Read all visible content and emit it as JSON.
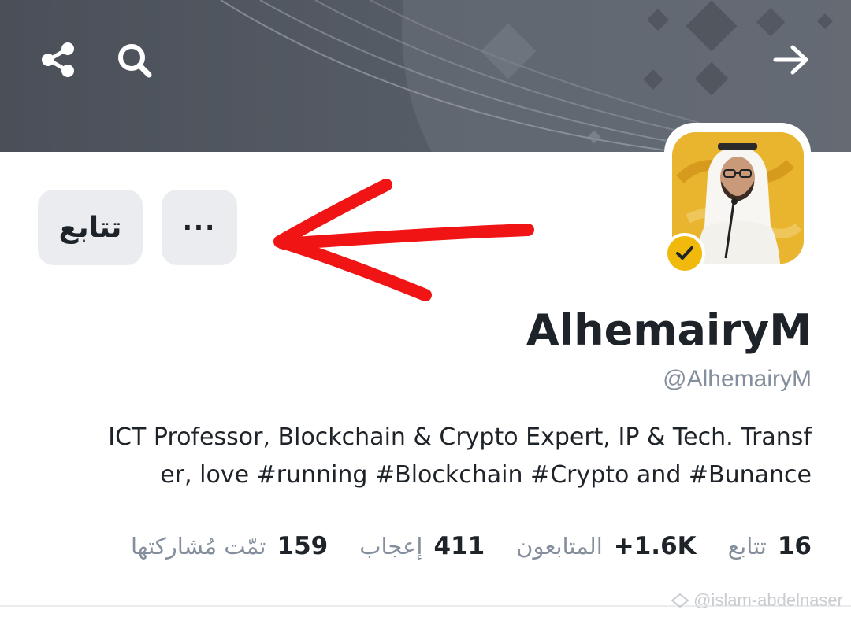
{
  "header": {
    "share_icon": "share-icon",
    "search_icon": "search-icon",
    "back_icon": "arrow-right-icon"
  },
  "actions": {
    "follow_label": "تتابع",
    "more_label": "···"
  },
  "profile": {
    "display_name": "AlhemairyM",
    "handle": "@AlhemairyM",
    "verified": true,
    "bio_lines": [
      "ICT Professor, Blockchain & Crypto Expert, IP & Tech. Transf",
      "er, love #running #Blockchain #Crypto and #Bunance"
    ]
  },
  "stats": [
    {
      "value": "16",
      "label": "تتابع"
    },
    {
      "value": "+1.6K",
      "label": "المتابعون"
    },
    {
      "value": "411",
      "label": "إعجاب"
    },
    {
      "value": "159",
      "label": "تمّت مُشاركتها"
    }
  ],
  "watermark": "@islam-abdelnaser",
  "colors": {
    "accent": "#f0b90b",
    "annotation_arrow": "#f01414",
    "muted_text": "#848e9c",
    "button_bg": "#eaecef"
  }
}
